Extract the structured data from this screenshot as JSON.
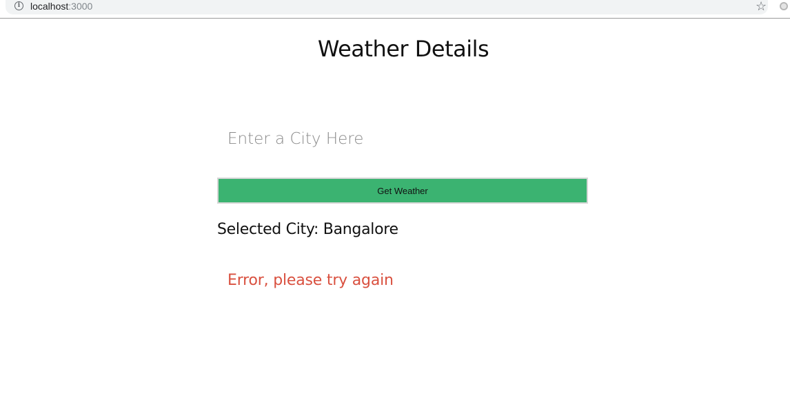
{
  "browser": {
    "url_host": "localhost",
    "url_port": ":3000"
  },
  "page": {
    "title": "Weather Details",
    "city_input": {
      "value": "",
      "placeholder": "Enter a City Here"
    },
    "get_weather_label": "Get Weather",
    "selected_city_label": "Selected City:",
    "selected_city_value": "Bangalore",
    "error_message": "Error, please try again"
  },
  "colors": {
    "button_bg": "#3bb371",
    "error_text": "#d9503f"
  },
  "icons": [
    "info-icon",
    "star-icon",
    "extension-icon"
  ]
}
